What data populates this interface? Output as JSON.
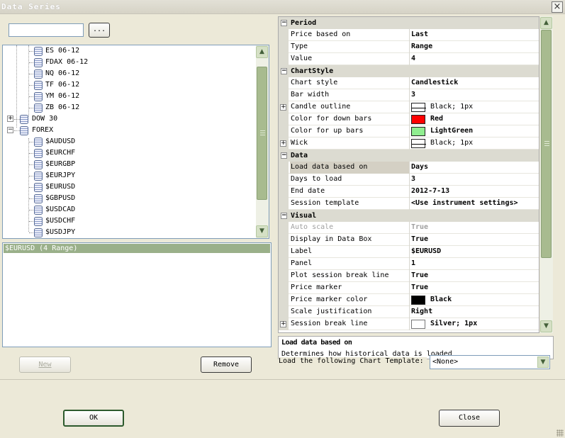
{
  "window": {
    "title": "Data Series"
  },
  "search": {
    "value": "",
    "browse_label": "..."
  },
  "tree": {
    "items": [
      {
        "label": "ES 06-12",
        "level": 2
      },
      {
        "label": "FDAX 06-12",
        "level": 2
      },
      {
        "label": "NQ 06-12",
        "level": 2
      },
      {
        "label": "TF 06-12",
        "level": 2
      },
      {
        "label": "YM 06-12",
        "level": 2
      },
      {
        "label": "ZB 06-12",
        "level": 2
      },
      {
        "label": "DOW 30",
        "level": 1,
        "expander": "+"
      },
      {
        "label": "FOREX",
        "level": 1,
        "expander": "−"
      },
      {
        "label": "$AUDUSD",
        "level": 2
      },
      {
        "label": "$EURCHF",
        "level": 2
      },
      {
        "label": "$EURGBP",
        "level": 2
      },
      {
        "label": "$EURJPY",
        "level": 2
      },
      {
        "label": "$EURUSD",
        "level": 2
      },
      {
        "label": "$GBPUSD",
        "level": 2
      },
      {
        "label": "$USDCAD",
        "level": 2
      },
      {
        "label": "$USDCHF",
        "level": 2
      },
      {
        "label": "$USDJPY",
        "level": 2
      }
    ]
  },
  "series_list": {
    "items": [
      "$EURUSD (4 Range)"
    ]
  },
  "buttons": {
    "new": "New",
    "remove": "Remove",
    "ok": "OK",
    "close": "Close"
  },
  "properties": {
    "period": {
      "title": "Period",
      "rows": [
        {
          "name": "Price based on",
          "value": "Last"
        },
        {
          "name": "Type",
          "value": "Range"
        },
        {
          "name": "Value",
          "value": "4"
        }
      ]
    },
    "chart_style": {
      "title": "ChartStyle",
      "rows": [
        {
          "name": "Chart style",
          "value": "Candlestick"
        },
        {
          "name": "Bar width",
          "value": "3"
        },
        {
          "name": "Candle outline",
          "value": "Black; 1px",
          "expander": "+"
        },
        {
          "name": "Color for down bars",
          "value": "Red"
        },
        {
          "name": "Color for up bars",
          "value": "LightGreen"
        },
        {
          "name": "Wick",
          "value": "Black; 1px",
          "expander": "+"
        }
      ]
    },
    "data": {
      "title": "Data",
      "rows": [
        {
          "name": "Load data based on",
          "value": "Days"
        },
        {
          "name": "Days to load",
          "value": "3"
        },
        {
          "name": "End date",
          "value": "2012-7-13"
        },
        {
          "name": "Session template",
          "value": "<Use instrument settings>"
        }
      ]
    },
    "visual": {
      "title": "Visual",
      "rows": [
        {
          "name": "Auto scale",
          "value": "True"
        },
        {
          "name": "Display in Data Box",
          "value": "True"
        },
        {
          "name": "Label",
          "value": "$EURUSD"
        },
        {
          "name": "Panel",
          "value": "1"
        },
        {
          "name": "Plot session break line",
          "value": "True"
        },
        {
          "name": "Price marker",
          "value": "True"
        },
        {
          "name": "Price marker color",
          "value": "Black"
        },
        {
          "name": "Scale justification",
          "value": "Right"
        },
        {
          "name": "Session break line",
          "value": "Silver; 1px",
          "expander": "+"
        }
      ]
    }
  },
  "colors": {
    "down_bars": "#ff0000",
    "up_bars": "#90ee90",
    "price_marker": "#000000",
    "accent": "#9ab08a"
  },
  "description": {
    "title": "Load data based on",
    "text": "Determines how historical data is loaded"
  },
  "template": {
    "label": "Load the following Chart Template:",
    "value": "<None>"
  }
}
